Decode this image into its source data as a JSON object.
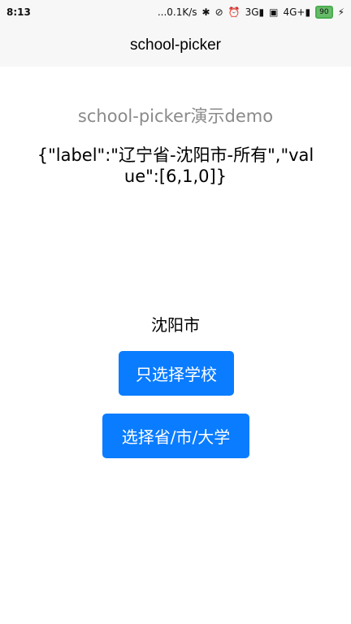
{
  "status_bar": {
    "time": "8:13",
    "network_speed": "...0.1K/s",
    "signal_label": "3G",
    "network_type": "4G+",
    "battery_level": "90"
  },
  "header": {
    "title": "school-picker"
  },
  "main": {
    "demo_title": "school-picker演示demo",
    "result_json": "{\"label\":\"辽宁省-沈阳市-所有\",\"value\":[6,1,0]}",
    "city_label": "沈阳市",
    "buttons": {
      "school_only": "只选择学校",
      "province_city_university": "选择省/市/大学"
    }
  },
  "colors": {
    "primary_button": "#0a7cff",
    "subtitle_text": "#8a8a8a",
    "header_bg": "#f7f7f7",
    "battery_green": "#66bb6a"
  }
}
